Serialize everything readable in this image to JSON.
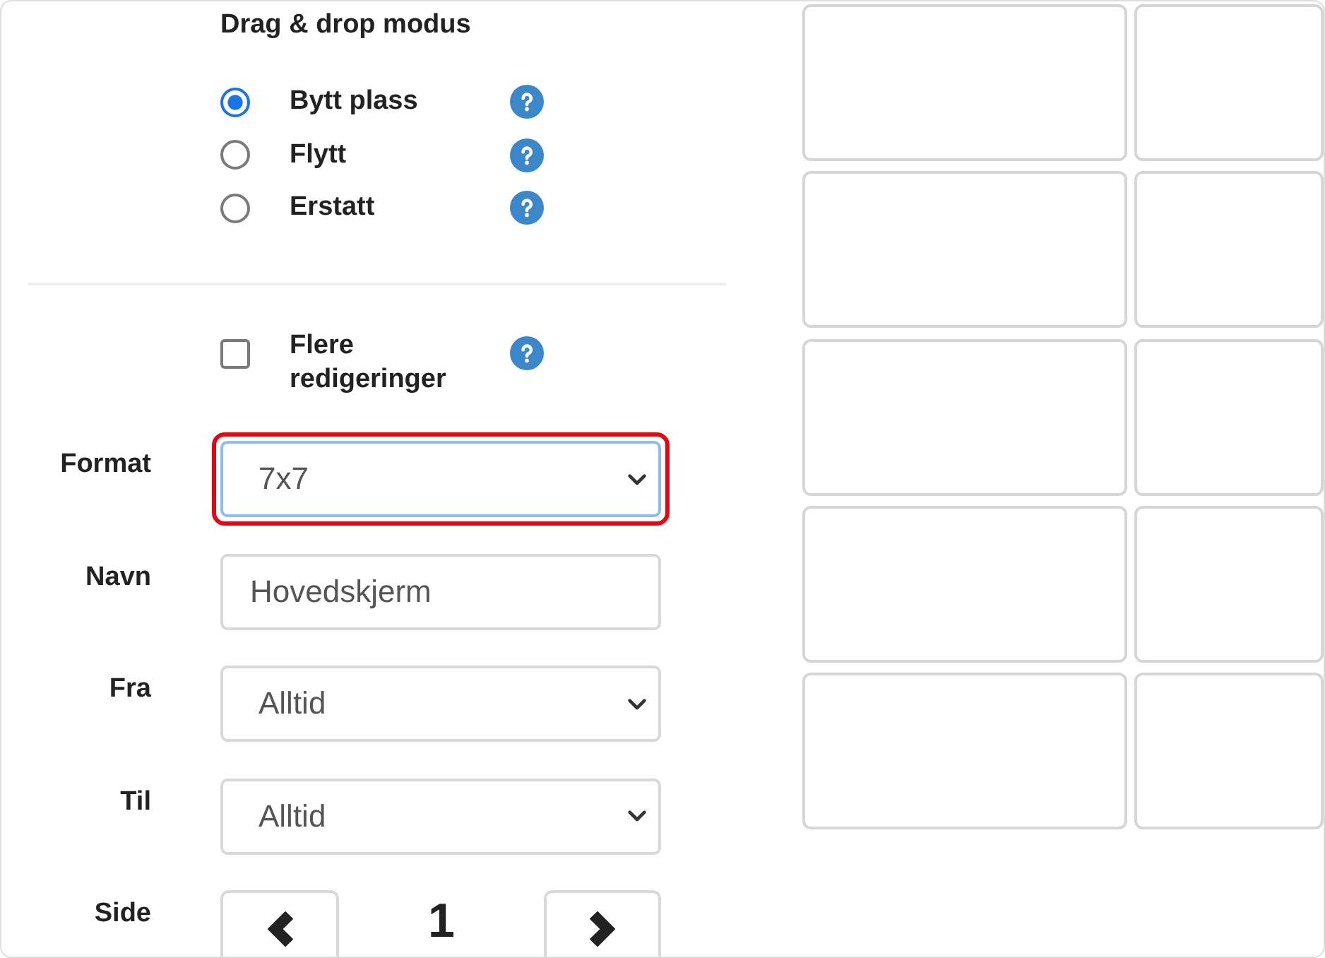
{
  "drag_drop_mode": {
    "title": "Drag & drop modus",
    "options": [
      {
        "label": "Bytt plass",
        "selected": true
      },
      {
        "label": "Flytt",
        "selected": false
      },
      {
        "label": "Erstatt",
        "selected": false
      }
    ]
  },
  "multi_edit": {
    "label": "Flere redigeringer",
    "checked": false
  },
  "form": {
    "fields": [
      {
        "kind": "select",
        "label": "Format",
        "value": "7x7",
        "focused": true,
        "highlighted": true
      },
      {
        "kind": "input",
        "label": "Navn",
        "value": "Hovedskjerm",
        "focused": false,
        "highlighted": false
      },
      {
        "kind": "select",
        "label": "Fra",
        "value": "Alltid",
        "focused": false,
        "highlighted": false
      },
      {
        "kind": "select",
        "label": "Til",
        "value": "Alltid",
        "focused": false,
        "highlighted": false
      },
      {
        "kind": "pager",
        "label": "Side",
        "value": "1"
      }
    ]
  },
  "tile_grid": {
    "tiles": [
      {
        "kind": "empty"
      },
      {
        "kind": "empty"
      },
      {
        "kind": "empty"
      },
      {
        "kind": "empty"
      },
      {
        "kind": "empty"
      },
      {
        "kind": "empty"
      },
      {
        "kind": "empty"
      },
      {
        "kind": "empty"
      },
      {
        "kind": "empty"
      },
      {
        "kind": "empty"
      }
    ]
  }
}
